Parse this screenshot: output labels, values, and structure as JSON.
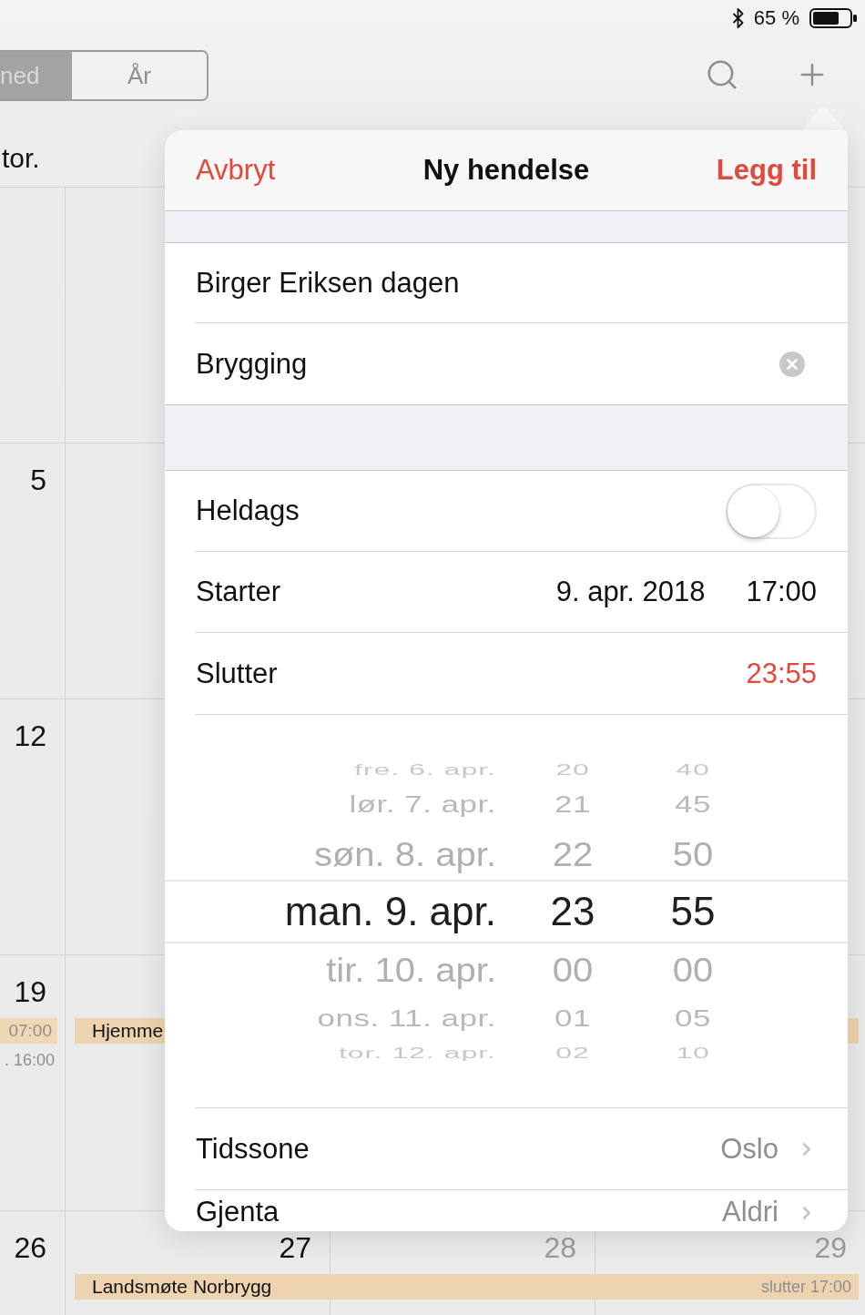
{
  "status_bar": {
    "battery": "65 %"
  },
  "toolbar": {
    "view_switcher": [
      {
        "label": "ned",
        "selected": true
      },
      {
        "label": "År",
        "selected": false
      }
    ]
  },
  "calendar": {
    "weekday": "tor.",
    "weeks": [
      {
        "dates": [
          {
            "text": "5",
            "weekend": false
          }
        ]
      },
      {
        "dates": [
          {
            "text": "12",
            "weekend": false
          }
        ]
      },
      {
        "dates": [
          {
            "text": "19",
            "weekend": false
          }
        ],
        "events": [
          {
            "kind": "time-bar",
            "title": "07:00"
          },
          {
            "kind": "time-text",
            "title": ". 16:00"
          },
          {
            "kind": "multi-day",
            "title": "Hjemme"
          }
        ]
      },
      {
        "dates": [
          {
            "text": "26",
            "weekend": false
          },
          {
            "text": "27",
            "weekend": false
          },
          {
            "text": "28",
            "weekend": true
          },
          {
            "text": "29",
            "weekend": true
          }
        ],
        "events": [
          {
            "kind": "multi-day",
            "title": "Landsmøte Norbrygg",
            "note": "slutter 17:00"
          }
        ]
      }
    ]
  },
  "popover": {
    "cancel": "Avbryt",
    "title": "Ny hendelse",
    "confirm": "Legg til",
    "fields": [
      {
        "value": "Birger Eriksen dagen",
        "focused": false
      },
      {
        "value": "Brygging",
        "focused": true
      }
    ],
    "settings": [
      {
        "kind": "switch",
        "label": "Heldags",
        "on": false
      },
      {
        "kind": "datetime",
        "label": "Starter",
        "date": "9. apr. 2018",
        "time": "17:00",
        "editing": false
      },
      {
        "kind": "datetime",
        "label": "Slutter",
        "time": "23:55",
        "editing": true
      },
      {
        "kind": "picker",
        "wheels": [
          {
            "kind": "date",
            "items": [
              {
                "text": "fre. 6. apr.",
                "selected": false
              },
              {
                "text": "lør. 7. apr.",
                "selected": false
              },
              {
                "text": "søn. 8. apr.",
                "selected": false
              },
              {
                "text": "man. 9. apr.",
                "selected": true
              },
              {
                "text": "tir. 10. apr.",
                "selected": false
              },
              {
                "text": "ons. 11. apr.",
                "selected": false
              },
              {
                "text": "tor. 12. apr.",
                "selected": false
              }
            ]
          },
          {
            "kind": "hour",
            "items": [
              {
                "text": "20",
                "selected": false
              },
              {
                "text": "21",
                "selected": false
              },
              {
                "text": "22",
                "selected": false
              },
              {
                "text": "23",
                "selected": true
              },
              {
                "text": "00",
                "selected": false
              },
              {
                "text": "01",
                "selected": false
              },
              {
                "text": "02",
                "selected": false
              }
            ]
          },
          {
            "kind": "minute",
            "items": [
              {
                "text": "40",
                "selected": false
              },
              {
                "text": "45",
                "selected": false
              },
              {
                "text": "50",
                "selected": false
              },
              {
                "text": "55",
                "selected": true
              },
              {
                "text": "00",
                "selected": false
              },
              {
                "text": "05",
                "selected": false
              },
              {
                "text": "10",
                "selected": false
              }
            ]
          }
        ]
      },
      {
        "kind": "link",
        "label": "Tidssone",
        "value": "Oslo"
      },
      {
        "kind": "link",
        "label": "Gjenta",
        "value": "Aldri"
      }
    ]
  }
}
